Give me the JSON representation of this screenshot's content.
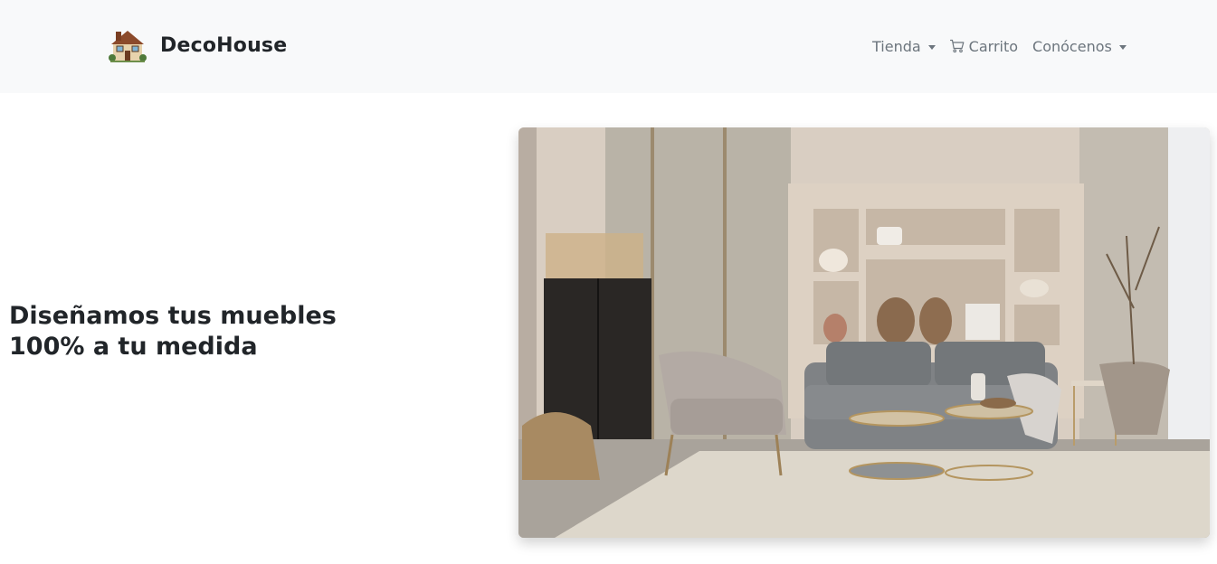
{
  "brand": {
    "name": "DecoHouse",
    "logo_icon": "house-icon"
  },
  "nav": {
    "items": [
      {
        "label": "Tienda",
        "dropdown": true
      },
      {
        "label": "Carrito",
        "icon": "cart-icon"
      },
      {
        "label": "Conócenos",
        "dropdown": true
      }
    ]
  },
  "hero": {
    "title": "Diseñamos tus muebles 100% a tu medida",
    "image_subject": "living-room-photo"
  },
  "colors": {
    "navbar_bg": "#f8f9fa",
    "nav_text": "#6c757d",
    "heading_text": "#212529"
  }
}
